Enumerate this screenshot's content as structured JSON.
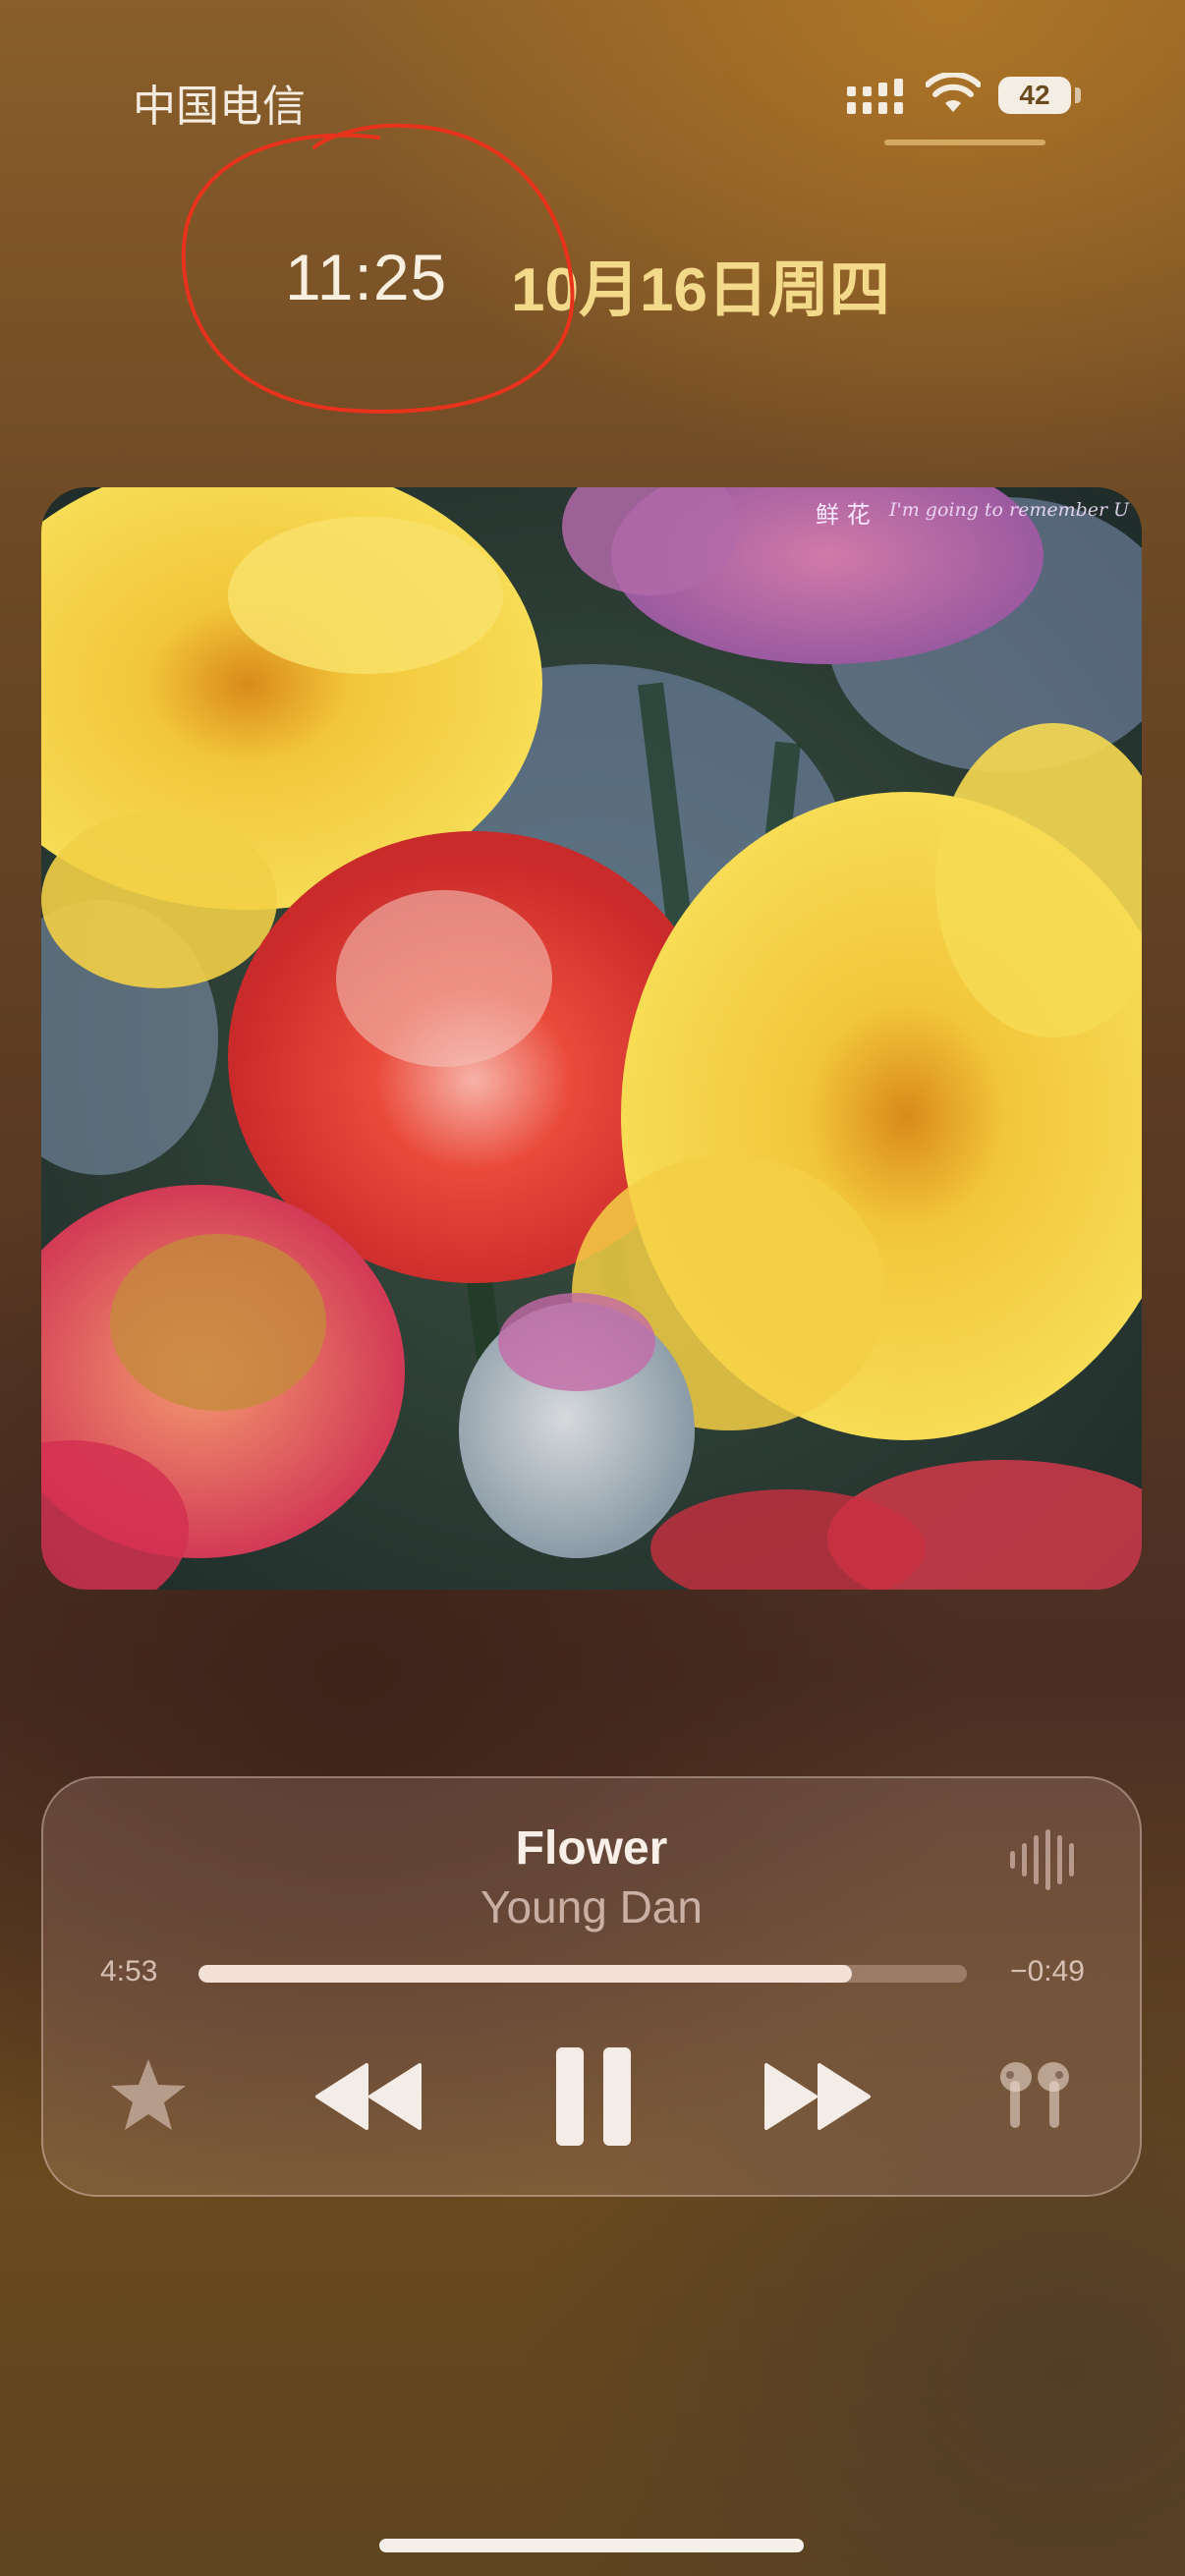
{
  "status_bar": {
    "carrier": "中国电信",
    "battery_level": "42",
    "signal_icon": "cellular-signal-icon",
    "wifi_icon": "wifi-icon"
  },
  "lock_screen": {
    "time": "11:25",
    "date": "10月16日周四"
  },
  "album": {
    "cover_title": "鲜 花",
    "cover_subtitle": "I'm going to remember U"
  },
  "now_playing": {
    "title": "Flower",
    "artist": "Young Dan",
    "elapsed": "4:53",
    "remaining": "−0:49",
    "progress": 0.85
  },
  "controls": {
    "favorite": "star-icon",
    "previous": "rewind-icon",
    "play_pause": "pause-icon",
    "next": "forward-icon",
    "output": "airpods-icon",
    "waveform": "waveform-icon"
  },
  "colors": {
    "date_accent": "#f3d98a",
    "annotation_red": "#e8321c",
    "progress_fill": "#f3e1d8"
  }
}
